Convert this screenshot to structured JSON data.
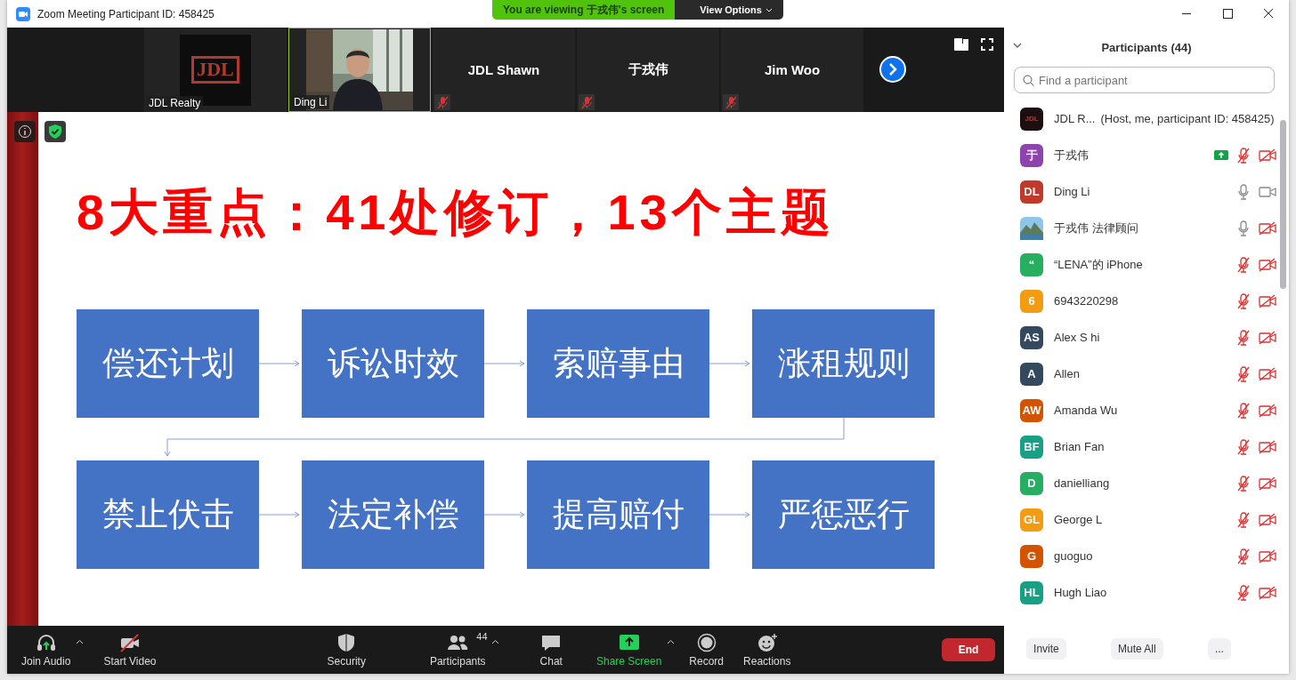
{
  "window": {
    "title": "Zoom Meeting Participant ID: 458425"
  },
  "banner": {
    "text": "You are viewing 于戎伟's screen",
    "view_options": "View Options"
  },
  "video_strip": [
    {
      "kind": "logo",
      "name": "JDL Realty",
      "logo_text": "JDL",
      "speaking": false
    },
    {
      "name": "Ding Li",
      "speaking": true
    },
    {
      "kind": "name",
      "name": "JDL Shawn",
      "muted": true,
      "speaking": false
    },
    {
      "kind": "name",
      "name": "于戎伟",
      "muted": true,
      "speaking": false
    },
    {
      "kind": "name",
      "name": "Jim Woo",
      "muted": true,
      "speaking": false
    }
  ],
  "slide": {
    "title": "8大重点：41处修订，13个主题",
    "boxes": [
      "偿还计划",
      "诉讼时效",
      "索赔事由",
      "涨租规则",
      "禁止伏击",
      "法定补偿",
      "提高赔付",
      "严惩恶行"
    ]
  },
  "toolbar": [
    {
      "kind": "audio",
      "label": "Join Audio"
    },
    {
      "kind": "video",
      "label": "Start Video"
    },
    {
      "kind": "security",
      "label": "Security"
    },
    {
      "kind": "participants",
      "label": "Participants",
      "count": "44"
    },
    {
      "kind": "chat",
      "label": "Chat"
    },
    {
      "kind": "share",
      "label": "Share Screen"
    },
    {
      "kind": "record",
      "label": "Record"
    },
    {
      "kind": "reactions",
      "label": "Reactions"
    }
  ],
  "end_button": "End",
  "participants": {
    "title": "Participants (44)",
    "search": {
      "placeholder": "Find a participant"
    },
    "items": [
      {
        "kind": "host",
        "avatar": {
          "kind": "logo",
          "logo_text": "JDL"
        },
        "name": "JDL R...",
        "note": "(Host, me, participant ID: 458425)"
      },
      {
        "kind": "guest",
        "avatar": {
          "kind": "initials",
          "initials": "于",
          "color": "#8e44ad"
        },
        "name": "于戎伟",
        "sharing": true,
        "muted": true,
        "video_off": true
      },
      {
        "kind": "guest",
        "avatar": {
          "kind": "initials",
          "initials": "DL",
          "color": "#c0392b"
        },
        "name": "Ding Li",
        "sharing": false,
        "muted": false,
        "video_off": false
      },
      {
        "kind": "guest",
        "name": "于戎伟 法律顾问",
        "sharing": false,
        "muted": false,
        "video_off": true
      },
      {
        "kind": "guest",
        "avatar": {
          "kind": "initials",
          "initials": "“",
          "color": "#27ae60"
        },
        "name": "“LENA”的 iPhone",
        "sharing": false,
        "muted": true,
        "video_off": true
      },
      {
        "kind": "guest",
        "avatar": {
          "kind": "initials",
          "initials": "6",
          "color": "#f39c12"
        },
        "name": "6943220298",
        "sharing": false,
        "muted": true,
        "video_off": true
      },
      {
        "kind": "guest",
        "avatar": {
          "kind": "initials",
          "initials": "AS",
          "color": "#34495e"
        },
        "name": "Alex S hi",
        "sharing": false,
        "muted": true,
        "video_off": true
      },
      {
        "kind": "guest",
        "avatar": {
          "kind": "initials",
          "initials": "A",
          "color": "#34495e"
        },
        "name": "Allen",
        "sharing": false,
        "muted": true,
        "video_off": true
      },
      {
        "kind": "guest",
        "avatar": {
          "kind": "initials",
          "initials": "AW",
          "color": "#d35400"
        },
        "name": "Amanda Wu",
        "sharing": false,
        "muted": true,
        "video_off": true
      },
      {
        "kind": "guest",
        "avatar": {
          "kind": "initials",
          "initials": "BF",
          "color": "#16a085"
        },
        "name": "Brian Fan",
        "sharing": false,
        "muted": true,
        "video_off": true
      },
      {
        "kind": "guest",
        "avatar": {
          "kind": "initials",
          "initials": "D",
          "color": "#27ae60"
        },
        "name": "danielliang",
        "sharing": false,
        "muted": true,
        "video_off": true
      },
      {
        "kind": "guest",
        "avatar": {
          "kind": "initials",
          "initials": "GL",
          "color": "#f39c12"
        },
        "name": "George L",
        "sharing": false,
        "muted": true,
        "video_off": true
      },
      {
        "kind": "guest",
        "avatar": {
          "kind": "initials",
          "initials": "G",
          "color": "#d35400"
        },
        "name": "guoguo",
        "sharing": false,
        "muted": true,
        "video_off": true
      },
      {
        "kind": "guest",
        "avatar": {
          "kind": "initials",
          "initials": "HL",
          "color": "#16a085"
        },
        "name": "Hugh Liao",
        "sharing": false,
        "muted": true,
        "video_off": true
      }
    ],
    "buttons": [
      "Invite",
      "Mute All",
      "..."
    ]
  }
}
